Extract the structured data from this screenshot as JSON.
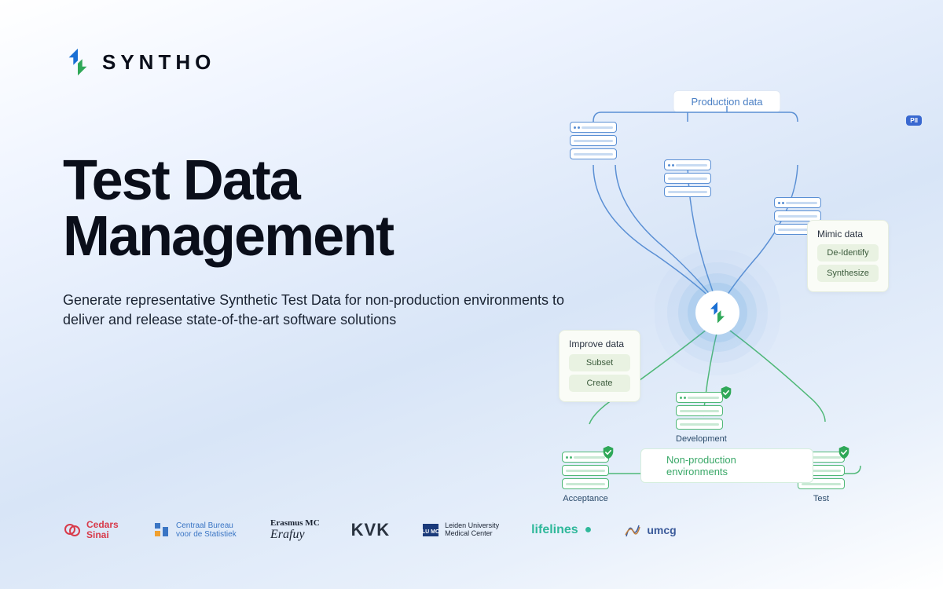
{
  "brand": {
    "name": "SYNTHO"
  },
  "hero": {
    "headline": "Test Data Management",
    "subhead": "Generate representative Synthetic Test Data for non-production environments to deliver and release state-of-the-art software solutions"
  },
  "diagram": {
    "top_label": "Production data",
    "bottom_label": "Non-production environments",
    "pii_badge": "PII",
    "card_mimic": {
      "title": "Mimic data",
      "items": [
        "De-Identify",
        "Synthesize"
      ]
    },
    "card_improve": {
      "title": "Improve data",
      "items": [
        "Subset",
        "Create"
      ]
    },
    "envs": [
      "Acceptance",
      "Development",
      "Test"
    ]
  },
  "partners": {
    "cedars": "Cedars Sinai",
    "cbs": "Centraal Bureau voor de Statistiek",
    "erasmus": "Erasmus MC",
    "kvk": "KVK",
    "lumc": "Leiden University Medical Center",
    "lifelines": "lifelines",
    "umcg": "umcg"
  }
}
